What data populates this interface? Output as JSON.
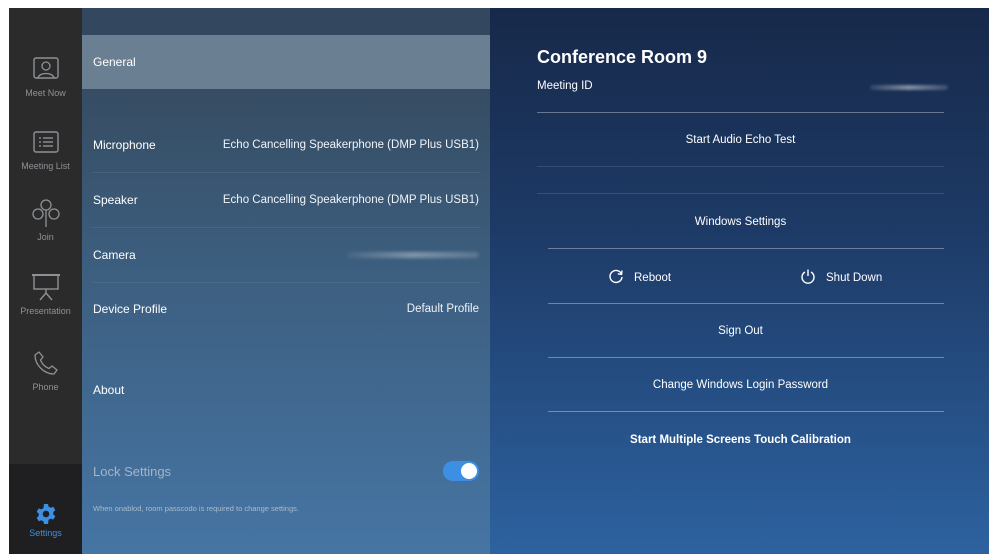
{
  "rail": {
    "items": [
      {
        "label": "Meet Now",
        "icon": "meet-now-icon"
      },
      {
        "label": "Meeting List",
        "icon": "meeting-list-icon"
      },
      {
        "label": "Join",
        "icon": "join-icon"
      },
      {
        "label": "Presentation",
        "icon": "presentation-icon"
      },
      {
        "label": "Phone",
        "icon": "phone-icon"
      }
    ],
    "settings_label": "Settings"
  },
  "settings_list": {
    "general": "General",
    "microphone_label": "Microphone",
    "microphone_value": "Echo Cancelling Speakerphone (DMP Plus USB1)",
    "speaker_label": "Speaker",
    "speaker_value": "Echo Cancelling Speakerphone (DMP Plus USB1)",
    "camera_label": "Camera",
    "device_profile_label": "Device Profile",
    "device_profile_value": "Default Profile",
    "about_label": "About",
    "lock_label": "Lock Settings",
    "lock_enabled": true,
    "lock_note": "When onablod, room passcodo is required to change settings."
  },
  "right_panel": {
    "room_name": "Conference Room 9",
    "meeting_id_label": "Meeting ID",
    "actions": {
      "audio_test": "Start Audio Echo Test",
      "windows_settings": "Windows Settings",
      "reboot": "Reboot",
      "shut_down": "Shut Down",
      "sign_out": "Sign Out",
      "change_password": "Change Windows Login Password",
      "touch_calibration": "Start Multiple Screens Touch Calibration"
    }
  },
  "colors": {
    "accent": "#3d8fe3",
    "rail_bg": "#2b2b2b",
    "selected_row": "#6b7f93"
  }
}
